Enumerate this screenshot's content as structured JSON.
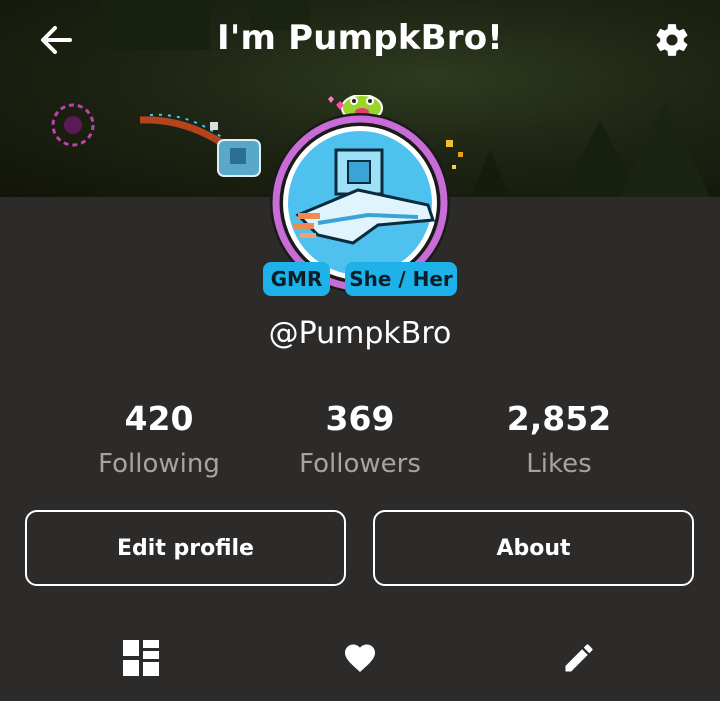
{
  "header": {
    "title": "I'm PumpkBro!",
    "back_icon": "arrow-left-icon",
    "settings_icon": "gear-icon"
  },
  "profile": {
    "badges": [
      "GMR",
      "She / Her"
    ],
    "handle": "@PumpkBro",
    "accent_color": "#1fb2e8",
    "frame_color": "#c86cd6"
  },
  "stats": [
    {
      "value": "420",
      "label": "Following"
    },
    {
      "value": "369",
      "label": "Followers"
    },
    {
      "value": "2,852",
      "label": "Likes"
    }
  ],
  "actions": {
    "edit_label": "Edit profile",
    "about_label": "About"
  },
  "tabs": [
    {
      "icon": "grid-layout-icon"
    },
    {
      "icon": "heart-icon"
    },
    {
      "icon": "pencil-icon"
    }
  ]
}
